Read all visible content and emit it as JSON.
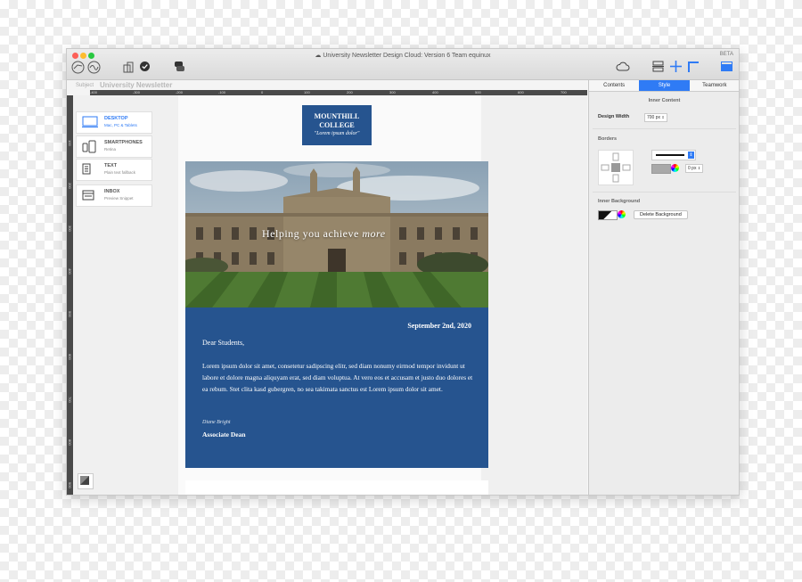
{
  "window": {
    "title": "University Newsletter Design Cloud: Version 6 Team equinux",
    "badge": "BETA"
  },
  "toolbar": {
    "left_icons": [
      "design-badge-icon",
      "signature-badge-icon",
      "layout-icon",
      "checkmark-icon",
      "chat-icon"
    ],
    "right_icons": [
      "cloud-icon",
      "insert-block-icon",
      "add-icon",
      "corner-icon",
      "sidebar-toggle-icon"
    ]
  },
  "subject": {
    "label": "Subject",
    "value": "University Newsletter"
  },
  "ruler": {
    "h_ticks": [
      "-400",
      "-300",
      "-200",
      "-100",
      "0",
      "100",
      "200",
      "300",
      "400",
      "500",
      "600",
      "700",
      "800",
      "900",
      "1000"
    ],
    "v_ticks": [
      "100",
      "200",
      "300",
      "400",
      "500",
      "600",
      "700",
      "800",
      "900"
    ]
  },
  "devices": [
    {
      "label": "DESKTOP",
      "sub": "Mac, PC & Tablets",
      "icon": "desktop-icon",
      "active": true
    },
    {
      "label": "SMARTPHONES",
      "sub": "Retina",
      "icon": "smartphone-icon",
      "active": false
    },
    {
      "label": "TEXT",
      "sub": "Plain text fallback",
      "icon": "text-doc-icon",
      "active": false
    },
    {
      "label": "INBOX",
      "sub": "Preview Snippet",
      "icon": "inbox-icon",
      "active": false
    }
  ],
  "email": {
    "logo_line1": "MOUNTHILL",
    "logo_line2": "COLLEGE",
    "logo_tagline": "\"Lorem ipsum dolor\"",
    "hero_text": "Helping you achieve",
    "hero_script": "more",
    "date": "September 2nd, 2020",
    "greeting": "Dear Students,",
    "body": "Lorem ipsum dolor sit amet, consetetur sadipscing elitr, sed diam nonumy eirmod tempor invidunt ut labore et dolore magna aliquyam erat, sed diam voluptua. At vero eos et accusam et justo duo dolores et ea rebum. Stet clita kasd gubergren, no sea takimata sanctus est Lorem ipsum dolor sit amet.",
    "signature": "Diane Bright",
    "signer_title": "Associate Dean"
  },
  "panel": {
    "tabs": [
      "Contents",
      "Style",
      "Teamwork"
    ],
    "active_tab": "Style",
    "inner_content_title": "Inner Content",
    "design_width_label": "Design Width",
    "design_width_value": "700 px",
    "borders_title": "Borders",
    "border_width_value": "0 px",
    "inner_background_title": "Inner Background",
    "delete_background_label": "Delete Background"
  },
  "colors": {
    "accent": "#2f7bf5",
    "email_blue": "#26548f"
  }
}
